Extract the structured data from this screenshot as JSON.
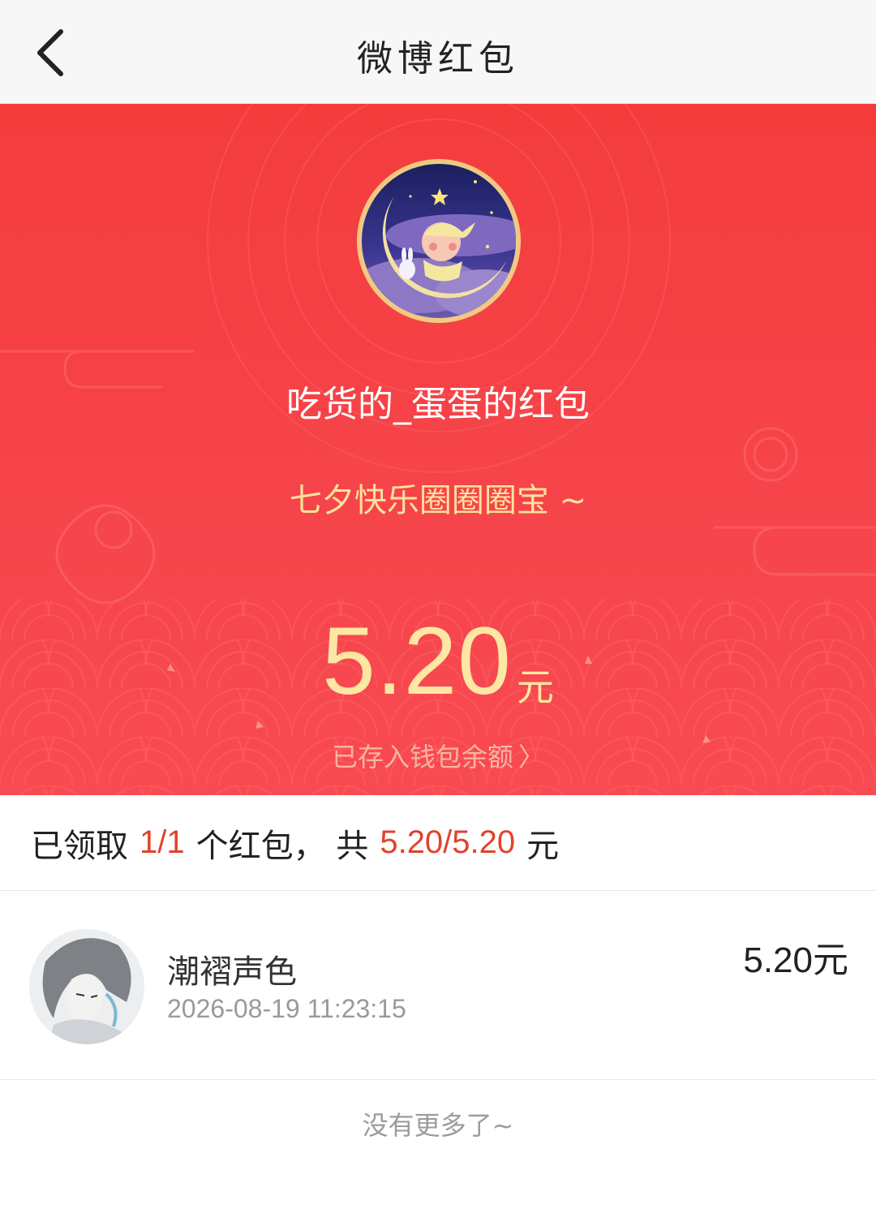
{
  "header": {
    "title": "微博红包",
    "back_icon": "chevron-left-icon"
  },
  "redpack": {
    "sender_title": "吃货的_蛋蛋的红包",
    "greeting": "七夕快乐圈圈圈宝 ~",
    "amount": "5.20",
    "amount_unit": "元",
    "wallet_link": "已存入钱包余额",
    "wallet_chevron": "〉",
    "colors": {
      "background": "#f43c3c",
      "gold": "#fde7a3",
      "ring": "#f2c983"
    }
  },
  "summary": {
    "prefix": "已领取",
    "count": "1/1",
    "middle": "个红包， 共",
    "total": "5.20/5.20",
    "suffix": "元"
  },
  "receivers": [
    {
      "name": "潮褶声色",
      "time": "2026-08-19 11:23:15",
      "amount": "5.20",
      "unit": "元"
    }
  ],
  "footer": {
    "no_more": "没有更多了~"
  }
}
